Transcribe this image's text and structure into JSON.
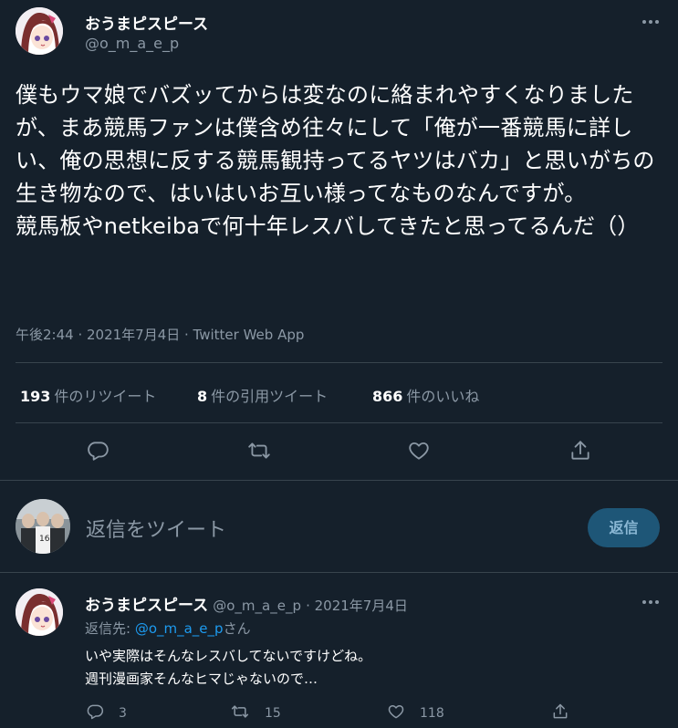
{
  "tweet": {
    "author_name": "おうまピスピース",
    "author_handle": "@o_m_a_e_p",
    "text": "僕もウマ娘でバズッてからは変なのに絡まれやすくなりましたが、まあ競馬ファンは僕含め往々にして「俺が一番競馬に詳しい、俺の思想に反する競馬観持ってるヤツはバカ」と思いがちの生き物なので、はいはいお互い様ってなものなんですが。\n競馬板やnetkeibaで何十年レスバしてきたと思ってるんだ（）",
    "timestamp": "午後2:44 · 2021年7月4日 · Twitter Web App",
    "stats": {
      "retweets_count": "193",
      "retweets_label": "件のリツイート",
      "quotes_count": "8",
      "quotes_label": "件の引用ツイート",
      "likes_count": "866",
      "likes_label": "件のいいね"
    }
  },
  "compose": {
    "placeholder": "返信をツイート",
    "button_label": "返信"
  },
  "reply": {
    "author_name": "おうまピスピース",
    "author_handle": "@o_m_a_e_p",
    "date": "· 2021年7月4日",
    "replying_prefix": "返信先: ",
    "replying_handle": "@o_m_a_e_p",
    "replying_suffix": "さん",
    "line1": "いや実際はそんなレスバしてないですけどね。",
    "line2": "週刊漫画家そんなヒマじゃないので…",
    "reply_count": "3",
    "retweet_count": "15",
    "like_count": "118"
  },
  "icons": {
    "reply": "reply-icon",
    "retweet": "retweet-icon",
    "like": "heart-icon",
    "share": "share-icon",
    "more": "more-icon"
  },
  "colors": {
    "background": "#15202b",
    "accent": "#1d9bf0",
    "muted": "#8b98a5",
    "divider": "#38444d"
  }
}
